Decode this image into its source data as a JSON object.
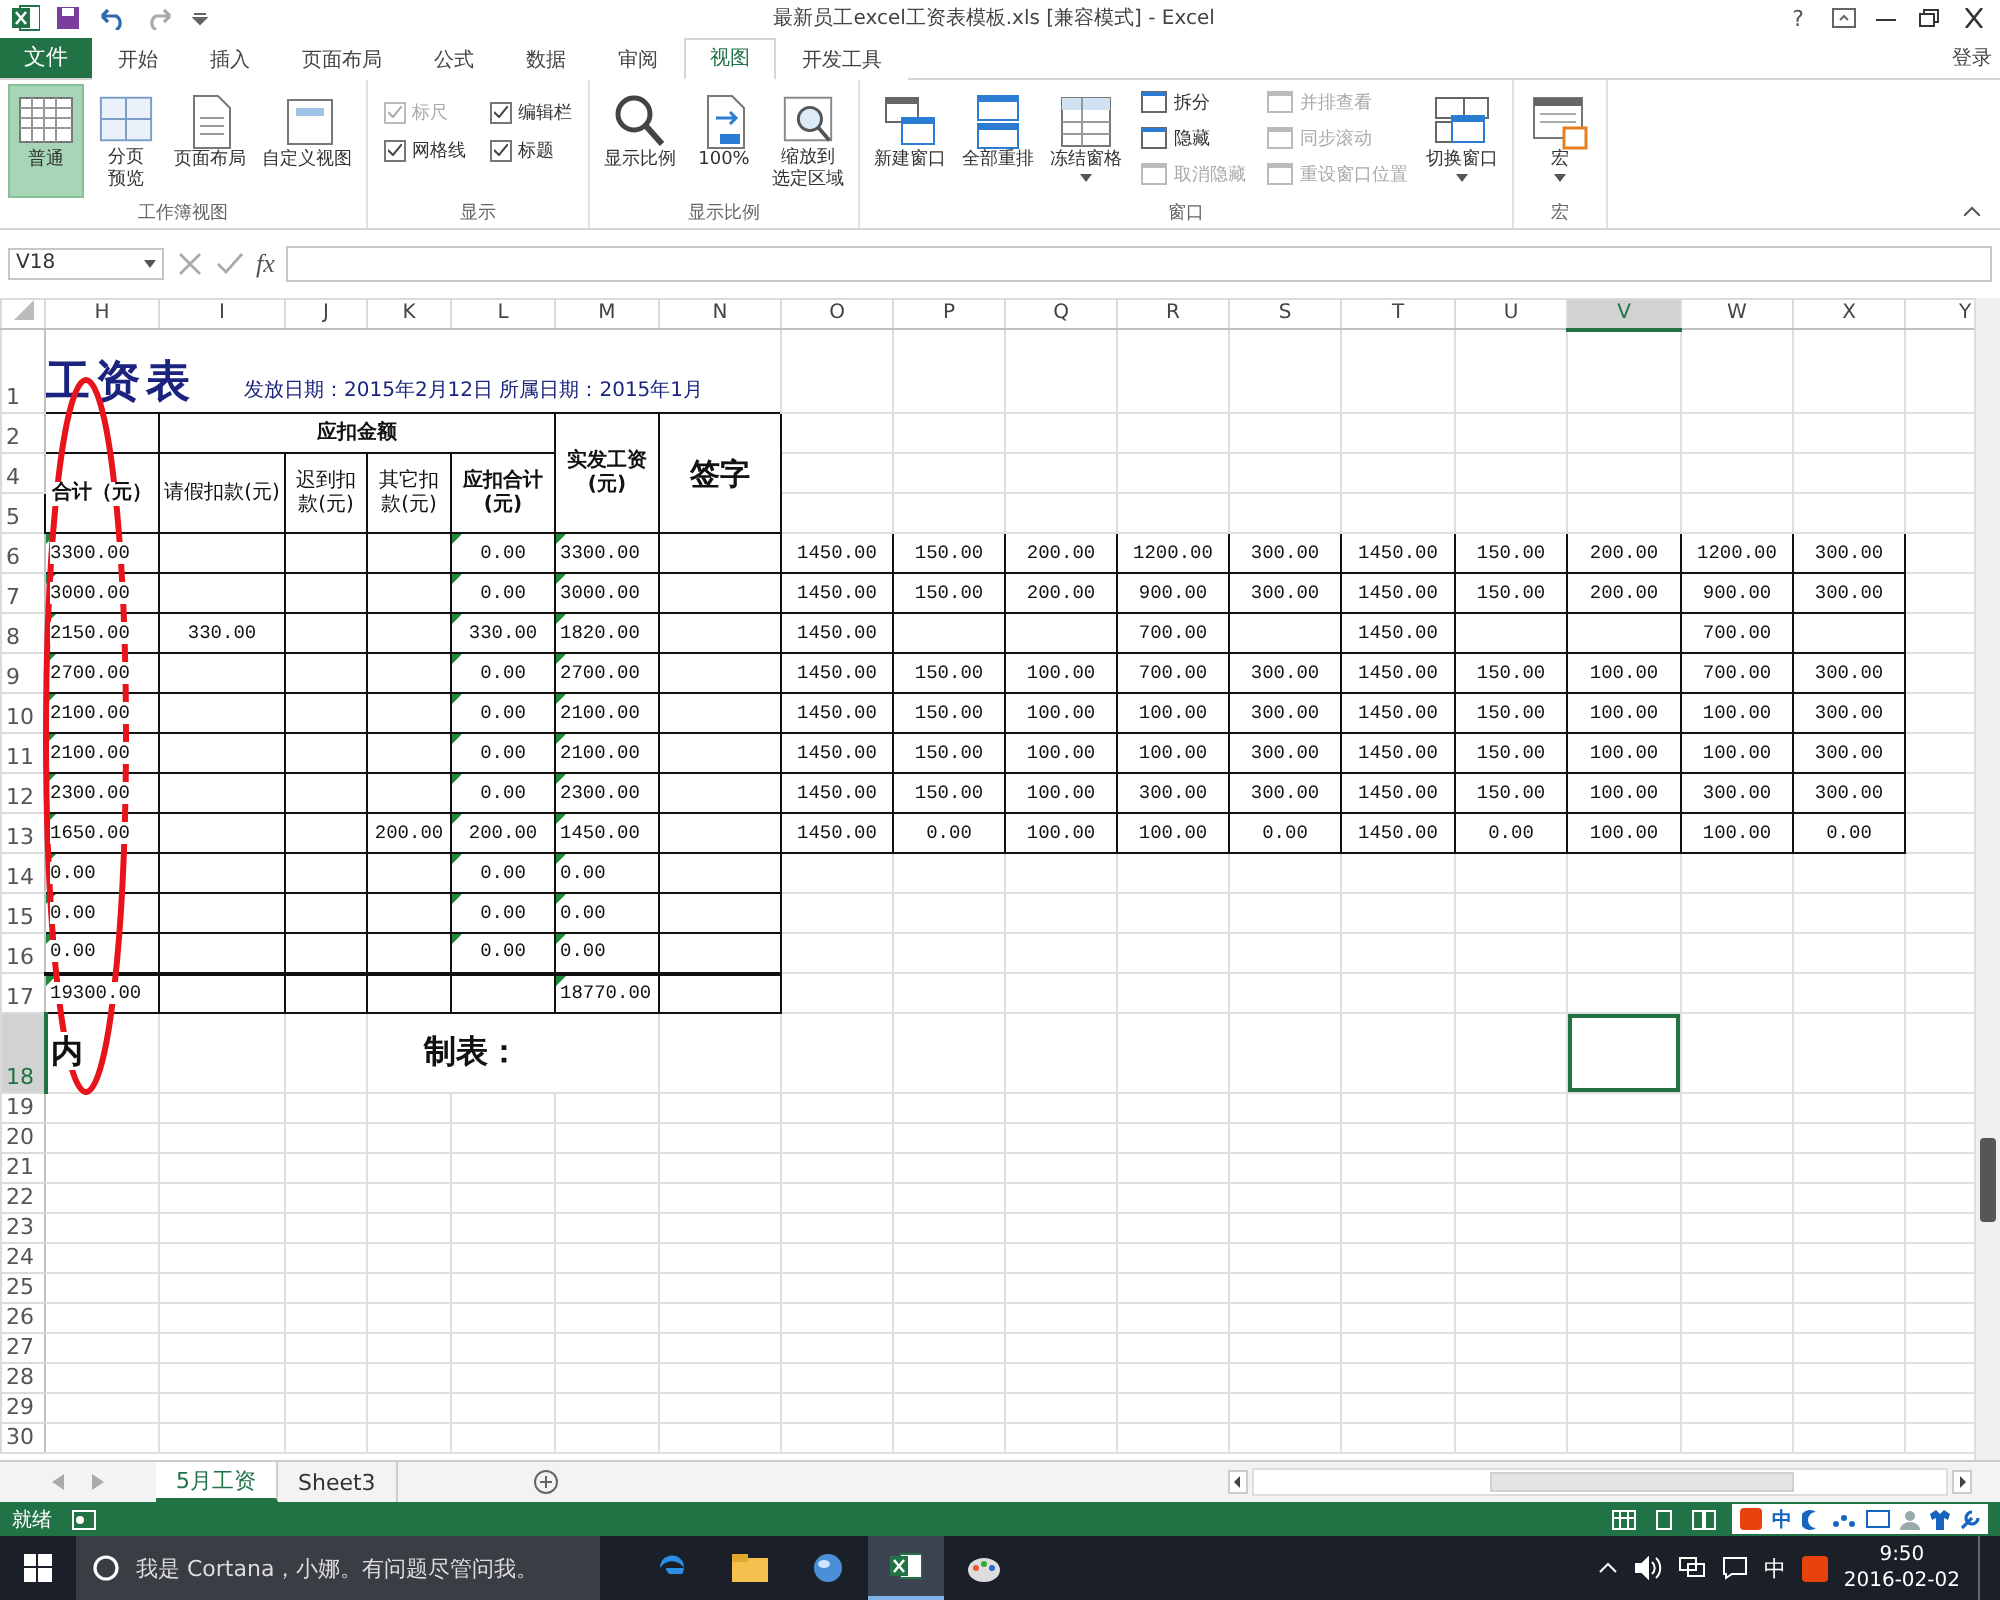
{
  "title_bar": {
    "title": "最新员工excel工资表模板.xls  [兼容模式] - Excel",
    "help": "?"
  },
  "file_tab": "文件",
  "tabs": [
    {
      "label": "开始",
      "selected": false
    },
    {
      "label": "插入",
      "selected": false
    },
    {
      "label": "页面布局",
      "selected": false
    },
    {
      "label": "公式",
      "selected": false
    },
    {
      "label": "数据",
      "selected": false
    },
    {
      "label": "审阅",
      "selected": false
    },
    {
      "label": "视图",
      "selected": true
    },
    {
      "label": "开发工具",
      "selected": false
    }
  ],
  "sign_in": "登录",
  "ribbon": [
    {
      "label": "工作簿视图",
      "items": [
        {
          "kind": "large",
          "label": "普通",
          "selected": true
        },
        {
          "kind": "large",
          "label": [
            "分页",
            "预览"
          ],
          "selected": false
        },
        {
          "kind": "large",
          "label": "页面布局",
          "selected": false
        },
        {
          "kind": "large",
          "label": "自定义视图",
          "selected": false
        }
      ]
    },
    {
      "label": "显示",
      "items": [
        {
          "kind": "checks",
          "items": [
            {
              "label": "标尺",
              "checked": true,
              "disabled": true
            },
            {
              "label": "编辑栏",
              "checked": true,
              "disabled": false
            },
            {
              "label": "网格线",
              "checked": true,
              "disabled": false
            },
            {
              "label": "标题",
              "checked": true,
              "disabled": false
            }
          ]
        }
      ]
    },
    {
      "label": "显示比例",
      "items": [
        {
          "kind": "large",
          "label": "显示比例"
        },
        {
          "kind": "large",
          "label": "100%"
        },
        {
          "kind": "large",
          "label": [
            "缩放到",
            "选定区域"
          ]
        }
      ]
    },
    {
      "label": "窗口",
      "items": [
        {
          "kind": "large",
          "label": "新建窗口"
        },
        {
          "kind": "large",
          "label": "全部重排"
        },
        {
          "kind": "large",
          "label": "冻结窗格",
          "dropdown": true
        },
        {
          "kind": "stack",
          "items": [
            {
              "label": "拆分",
              "disabled": false
            },
            {
              "label": "隐藏",
              "disabled": false
            },
            {
              "label": "取消隐藏",
              "disabled": true
            }
          ]
        },
        {
          "kind": "stack",
          "items": [
            {
              "label": "并排查看",
              "disabled": true
            },
            {
              "label": "同步滚动",
              "disabled": true
            },
            {
              "label": "重设窗口位置",
              "disabled": true
            }
          ]
        },
        {
          "kind": "large",
          "label": "切换窗口",
          "dropdown": true
        }
      ]
    },
    {
      "label": "宏",
      "items": [
        {
          "kind": "large",
          "label": "宏",
          "dropdown": true
        }
      ]
    }
  ],
  "formula_bar": {
    "name_box": "V18",
    "function_label": "fx"
  },
  "columns": [
    {
      "label": "H",
      "selected": false
    },
    {
      "label": "I",
      "selected": false
    },
    {
      "label": "J",
      "selected": false
    },
    {
      "label": "K",
      "selected": false
    },
    {
      "label": "L",
      "selected": false
    },
    {
      "label": "M",
      "selected": false
    },
    {
      "label": "N",
      "selected": false
    },
    {
      "label": "O",
      "selected": false
    },
    {
      "label": "P",
      "selected": false
    },
    {
      "label": "Q",
      "selected": false
    },
    {
      "label": "R",
      "selected": false
    },
    {
      "label": "S",
      "selected": false
    },
    {
      "label": "T",
      "selected": false
    },
    {
      "label": "U",
      "selected": false
    },
    {
      "label": "V",
      "selected": true
    },
    {
      "label": "W",
      "selected": false
    },
    {
      "label": "X",
      "selected": false
    },
    {
      "label": "Y",
      "selected": false
    }
  ],
  "rows": [
    {
      "label": "1",
      "selected": false
    },
    {
      "label": "2",
      "selected": false
    },
    {
      "label": "4",
      "selected": false
    },
    {
      "label": "5",
      "selected": false
    },
    {
      "label": "6",
      "selected": false
    },
    {
      "label": "7",
      "selected": false
    },
    {
      "label": "8",
      "selected": false
    },
    {
      "label": "9",
      "selected": false
    },
    {
      "label": "10",
      "selected": false
    },
    {
      "label": "11",
      "selected": false
    },
    {
      "label": "12",
      "selected": false
    },
    {
      "label": "13",
      "selected": false
    },
    {
      "label": "14",
      "selected": false
    },
    {
      "label": "15",
      "selected": false
    },
    {
      "label": "16",
      "selected": false
    },
    {
      "label": "17",
      "selected": false
    },
    {
      "label": "18",
      "selected": true
    },
    {
      "label": "19",
      "selected": false
    },
    {
      "label": "20",
      "selected": false
    },
    {
      "label": "21",
      "selected": false
    },
    {
      "label": "22",
      "selected": false
    },
    {
      "label": "23",
      "selected": false
    },
    {
      "label": "24",
      "selected": false
    },
    {
      "label": "25",
      "selected": false
    },
    {
      "label": "26",
      "selected": false
    },
    {
      "label": "27",
      "selected": false
    },
    {
      "label": "28",
      "selected": false
    },
    {
      "label": "29",
      "selected": false
    },
    {
      "label": "30",
      "selected": false
    }
  ],
  "sheet": {
    "title": "工资表",
    "subtitle": "发放日期：2015年2月12日  所属日期：2015年1月",
    "group_header": "应扣金额",
    "headers": [
      "合计（元）",
      "请假扣款(元)",
      "迟到扣款(元)",
      "其它扣款(元)",
      "应扣合计(元)",
      "实发工资(元)",
      "签字"
    ],
    "rows": [
      [
        "3300.00",
        "",
        "",
        "",
        "0.00",
        "3300.00",
        ""
      ],
      [
        "3000.00",
        "",
        "",
        "",
        "0.00",
        "3000.00",
        ""
      ],
      [
        "2150.00",
        "330.00",
        "",
        "",
        "330.00",
        "1820.00",
        ""
      ],
      [
        "2700.00",
        "",
        "",
        "",
        "0.00",
        "2700.00",
        ""
      ],
      [
        "2100.00",
        "",
        "",
        "",
        "0.00",
        "2100.00",
        ""
      ],
      [
        "2100.00",
        "",
        "",
        "",
        "0.00",
        "2100.00",
        ""
      ],
      [
        "2300.00",
        "",
        "",
        "",
        "0.00",
        "2300.00",
        ""
      ],
      [
        "1650.00",
        "",
        "",
        "200.00",
        "200.00",
        "1450.00",
        ""
      ],
      [
        "0.00",
        "",
        "",
        "",
        "0.00",
        "0.00",
        ""
      ],
      [
        "0.00",
        "",
        "",
        "",
        "0.00",
        "0.00",
        ""
      ],
      [
        "0.00",
        "",
        "",
        "",
        "0.00",
        "0.00",
        ""
      ]
    ],
    "total": {
      "sum": "19300.00",
      "net_pay": "18770.00"
    },
    "footer_left": "内",
    "footer_right": "制表："
  },
  "right_table": {
    "rows": [
      [
        "1450.00",
        "150.00",
        "200.00",
        "1200.00",
        "300.00",
        "1450.00",
        "150.00",
        "200.00",
        "1200.00",
        "300.00"
      ],
      [
        "1450.00",
        "150.00",
        "200.00",
        "900.00",
        "300.00",
        "1450.00",
        "150.00",
        "200.00",
        "900.00",
        "300.00"
      ],
      [
        "1450.00",
        "",
        "",
        "700.00",
        "",
        "1450.00",
        "",
        "",
        "700.00",
        ""
      ],
      [
        "1450.00",
        "150.00",
        "100.00",
        "700.00",
        "300.00",
        "1450.00",
        "150.00",
        "100.00",
        "700.00",
        "300.00"
      ],
      [
        "1450.00",
        "150.00",
        "100.00",
        "100.00",
        "300.00",
        "1450.00",
        "150.00",
        "100.00",
        "100.00",
        "300.00"
      ],
      [
        "1450.00",
        "150.00",
        "100.00",
        "100.00",
        "300.00",
        "1450.00",
        "150.00",
        "100.00",
        "100.00",
        "300.00"
      ],
      [
        "1450.00",
        "150.00",
        "100.00",
        "300.00",
        "300.00",
        "1450.00",
        "150.00",
        "100.00",
        "300.00",
        "300.00"
      ],
      [
        "1450.00",
        "0.00",
        "100.00",
        "100.00",
        "0.00",
        "1450.00",
        "0.00",
        "100.00",
        "100.00",
        "0.00"
      ]
    ]
  },
  "sheet_tabs": [
    {
      "label": "5月工资",
      "selected": true
    },
    {
      "label": "Sheet3",
      "selected": false
    }
  ],
  "status_bar": {
    "text": "就绪",
    "ime": "中"
  },
  "taskbar": {
    "search": {
      "placeholder": "我是 Cortana，小娜。有问题尽管问我。"
    },
    "ime": "中",
    "time": "9:50",
    "date": "2016-02-02"
  }
}
